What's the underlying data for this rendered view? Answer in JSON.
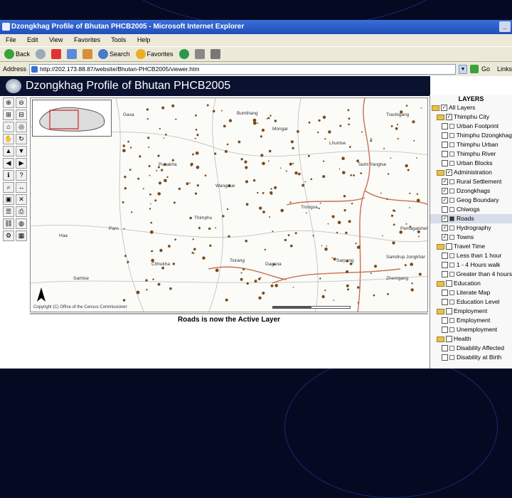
{
  "window": {
    "title": "Dzongkhag Profile of Bhutan PHCB2005 - Microsoft Internet Explorer",
    "menu": [
      "File",
      "Edit",
      "View",
      "Favorites",
      "Tools",
      "Help"
    ],
    "toolbar": {
      "back": "Back",
      "search": "Search",
      "favorites": "Favorites"
    },
    "address_label": "Address",
    "url": "http://202.173.88.87/website/Bhutan-PHCB2005/viewer.htm",
    "go_label": "Go",
    "links_label": "Links"
  },
  "page": {
    "header_title": "Dzongkhag Profile of Bhutan PHCB2005",
    "copyright": "Copyright (C) Office of the Census Commissioner",
    "status_text": "Roads is now the Active Layer",
    "places": [
      "Gasa",
      "Bumthang",
      "Mongar",
      "Trashigang",
      "Tashi Yangtse",
      "Punakha",
      "Wangdue",
      "Thimphu",
      "Paro",
      "Haa",
      "Samtse",
      "Chhukha",
      "Tsirang",
      "Dagana",
      "Sarpang",
      "Zhemgang",
      "Trongsa",
      "Pemagatshel",
      "Samdrup Jongkhar",
      "Lhuntse"
    ]
  },
  "layers": {
    "header": "LAYERS",
    "items": [
      {
        "label": "All Layers",
        "type": "folder",
        "checked": true,
        "level": 0
      },
      {
        "label": "Thimphu City",
        "type": "folder",
        "checked": true,
        "level": 1
      },
      {
        "label": "Urban Footprint",
        "type": "layer",
        "checked": false,
        "level": 2
      },
      {
        "label": "Thimphu Dzongkhag",
        "type": "layer",
        "checked": false,
        "level": 2
      },
      {
        "label": "Thimphu Urban",
        "type": "layer",
        "checked": false,
        "level": 2
      },
      {
        "label": "Thimphu River",
        "type": "layer",
        "checked": false,
        "level": 2
      },
      {
        "label": "Urban Blocks",
        "type": "layer",
        "checked": false,
        "level": 2
      },
      {
        "label": "Administration",
        "type": "folder",
        "checked": true,
        "level": 1
      },
      {
        "label": "Rural Settlement",
        "type": "layer",
        "checked": true,
        "level": 2
      },
      {
        "label": "Dzongkhags",
        "type": "layer",
        "checked": true,
        "level": 2
      },
      {
        "label": "Geog Boundary",
        "type": "layer",
        "checked": true,
        "level": 2
      },
      {
        "label": "Chiwogs",
        "type": "layer",
        "checked": false,
        "level": 2
      },
      {
        "label": "Roads",
        "type": "layer",
        "checked": true,
        "level": 2,
        "active": true
      },
      {
        "label": "Hydrography",
        "type": "layer",
        "checked": true,
        "level": 2
      },
      {
        "label": "Towns",
        "type": "layer",
        "checked": true,
        "level": 2
      },
      {
        "label": "Travel Time",
        "type": "folder",
        "checked": false,
        "level": 1
      },
      {
        "label": "Less than 1 hour",
        "type": "layer",
        "checked": false,
        "level": 2
      },
      {
        "label": "1 - 4 Hours walk",
        "type": "layer",
        "checked": false,
        "level": 2
      },
      {
        "label": "Greater than 4 hours",
        "type": "layer",
        "checked": false,
        "level": 2
      },
      {
        "label": "Education",
        "type": "folder",
        "checked": false,
        "level": 1
      },
      {
        "label": "Literate Map",
        "type": "layer",
        "checked": false,
        "level": 2
      },
      {
        "label": "Education Level",
        "type": "layer",
        "checked": false,
        "level": 2
      },
      {
        "label": "Employment",
        "type": "folder",
        "checked": false,
        "level": 1
      },
      {
        "label": "Employment",
        "type": "layer",
        "checked": false,
        "level": 2
      },
      {
        "label": "Unemployment",
        "type": "layer",
        "checked": false,
        "level": 2
      },
      {
        "label": "Health",
        "type": "folder",
        "checked": false,
        "level": 1
      },
      {
        "label": "Disability Affected",
        "type": "layer",
        "checked": false,
        "level": 2
      },
      {
        "label": "Disability at Birth",
        "type": "layer",
        "checked": false,
        "level": 2
      }
    ]
  },
  "tools": [
    "zoom-in",
    "zoom-out",
    "zoom-in-box",
    "zoom-out-box",
    "full-extent",
    "zoom-active",
    "pan",
    "refresh",
    "pan-north",
    "pan-south",
    "pan-west",
    "pan-east",
    "identify",
    "query",
    "find",
    "measure",
    "select",
    "clear",
    "legend",
    "print",
    "hyperlink",
    "buffer",
    "options",
    "overview"
  ]
}
